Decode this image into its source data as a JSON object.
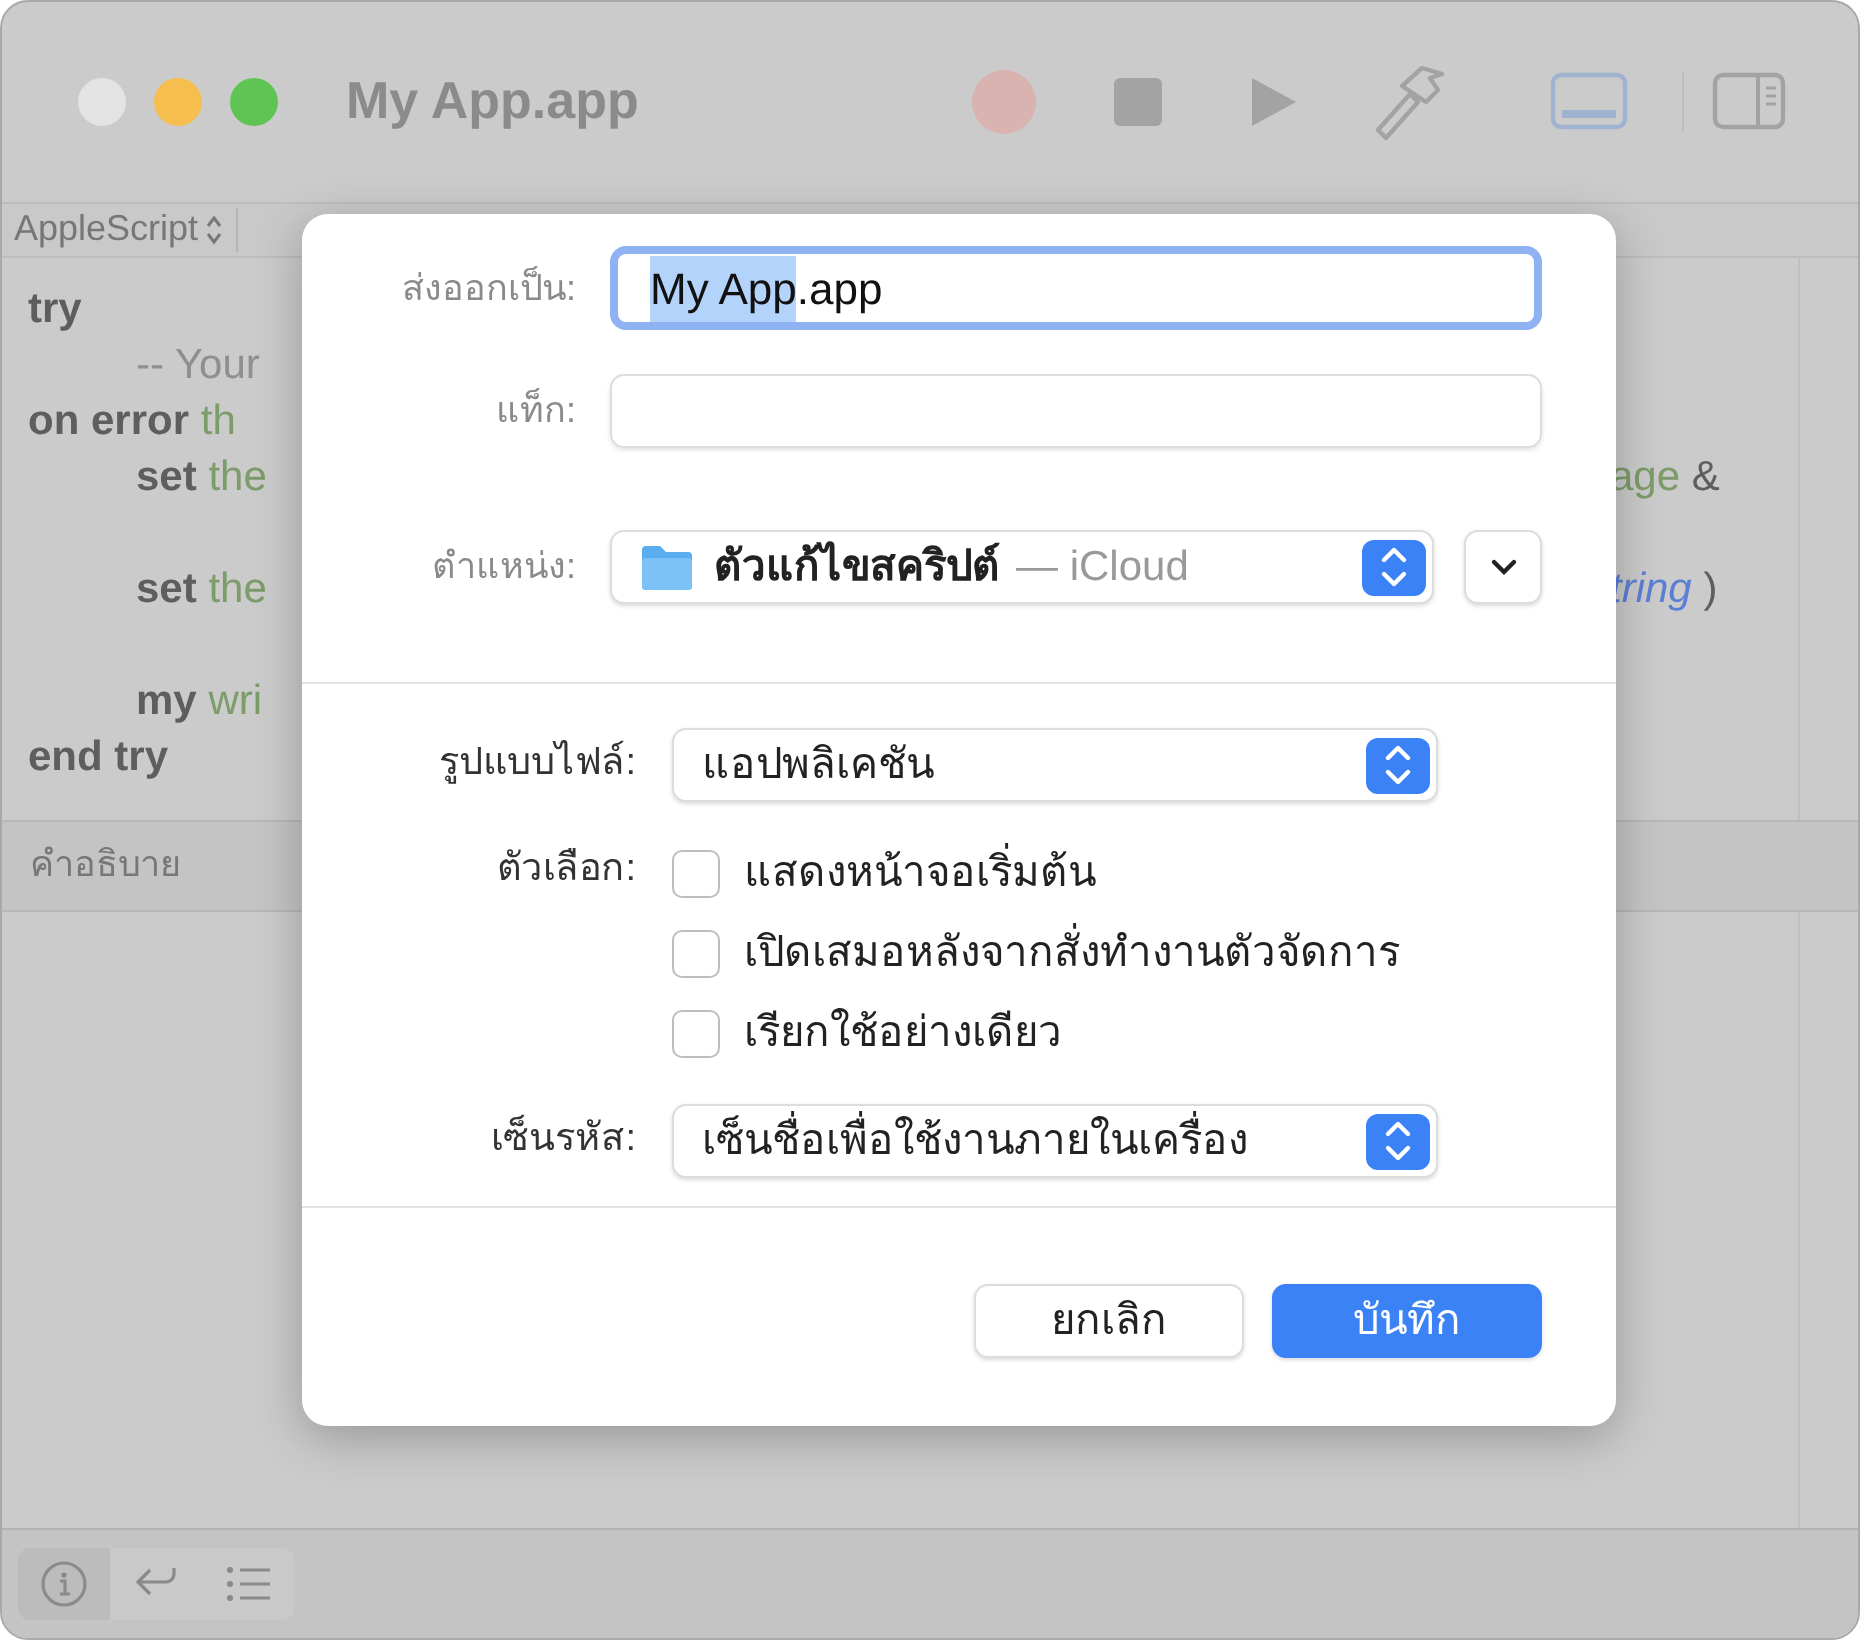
{
  "window": {
    "title": "My App.app"
  },
  "navigator": {
    "language": "AppleScript"
  },
  "code_lines": [
    {
      "kind": "code",
      "left": [
        {
          "kind": "keyword",
          "text": "try"
        }
      ],
      "children": [
        {
          "kind": "code",
          "left": [
            {
              "kind": "comment",
              "text": "-- Your"
            }
          ]
        }
      ]
    },
    {
      "kind": "code",
      "left": [
        {
          "kind": "keyword",
          "text": "on error"
        },
        {
          "kind": "variable",
          "text": "th"
        }
      ],
      "children": [
        {
          "kind": "code",
          "left": [
            {
              "kind": "keyword",
              "text": "set"
            },
            {
              "kind": "variable",
              "text": "the"
            }
          ],
          "right": [
            {
              "kind": "variable",
              "text": "age"
            },
            {
              "kind": "operator",
              "text": "&"
            }
          ]
        },
        {
          "kind": "blank"
        },
        {
          "kind": "code",
          "left": [
            {
              "kind": "keyword",
              "text": "set"
            },
            {
              "kind": "variable",
              "text": "the"
            }
          ],
          "right": [
            {
              "kind": "class",
              "text": "tring"
            },
            {
              "kind": "operator",
              "text": ")"
            }
          ]
        },
        {
          "kind": "blank"
        },
        {
          "kind": "code",
          "left": [
            {
              "kind": "keyword",
              "text": "my"
            },
            {
              "kind": "variable",
              "text": "wri"
            }
          ]
        }
      ]
    },
    {
      "kind": "code",
      "left": [
        {
          "kind": "keyword",
          "text": "end try"
        }
      ]
    }
  ],
  "description_bar": {
    "label": "คำอธิบาย"
  },
  "bottom_tabs": [
    {
      "kind": "info",
      "selected": true
    },
    {
      "kind": "return",
      "selected": false
    },
    {
      "kind": "list",
      "selected": false
    }
  ],
  "dialog": {
    "export_as": {
      "label": "ส่งออกเป็น:",
      "value_selected": "My App",
      "value_rest": ".app"
    },
    "tags": {
      "label": "แท็ก:"
    },
    "location": {
      "label": "ตำแหน่ง:",
      "folder": "ตัวแก้ไขสคริปต์",
      "place": "— iCloud"
    },
    "file_format": {
      "label": "รูปแบบไฟล์:",
      "value": "แอปพลิเคชัน"
    },
    "options": {
      "label": "ตัวเลือก:",
      "items": [
        {
          "label": "แสดงหน้าจอเริ่มต้น",
          "checked": false
        },
        {
          "label": "เปิดเสมอหลังจากสั่งทำงานตัวจัดการ",
          "checked": false
        },
        {
          "label": "เรียกใช้อย่างเดียว",
          "checked": false
        }
      ]
    },
    "code_sign": {
      "label": "เซ็นรหัส:",
      "value": "เซ็นชื่อเพื่อใช้งานภายในเครื่อง"
    },
    "buttons": [
      {
        "label": "ยกเลิก",
        "kind": "cancel"
      },
      {
        "label": "บันทึก",
        "kind": "default"
      }
    ]
  }
}
